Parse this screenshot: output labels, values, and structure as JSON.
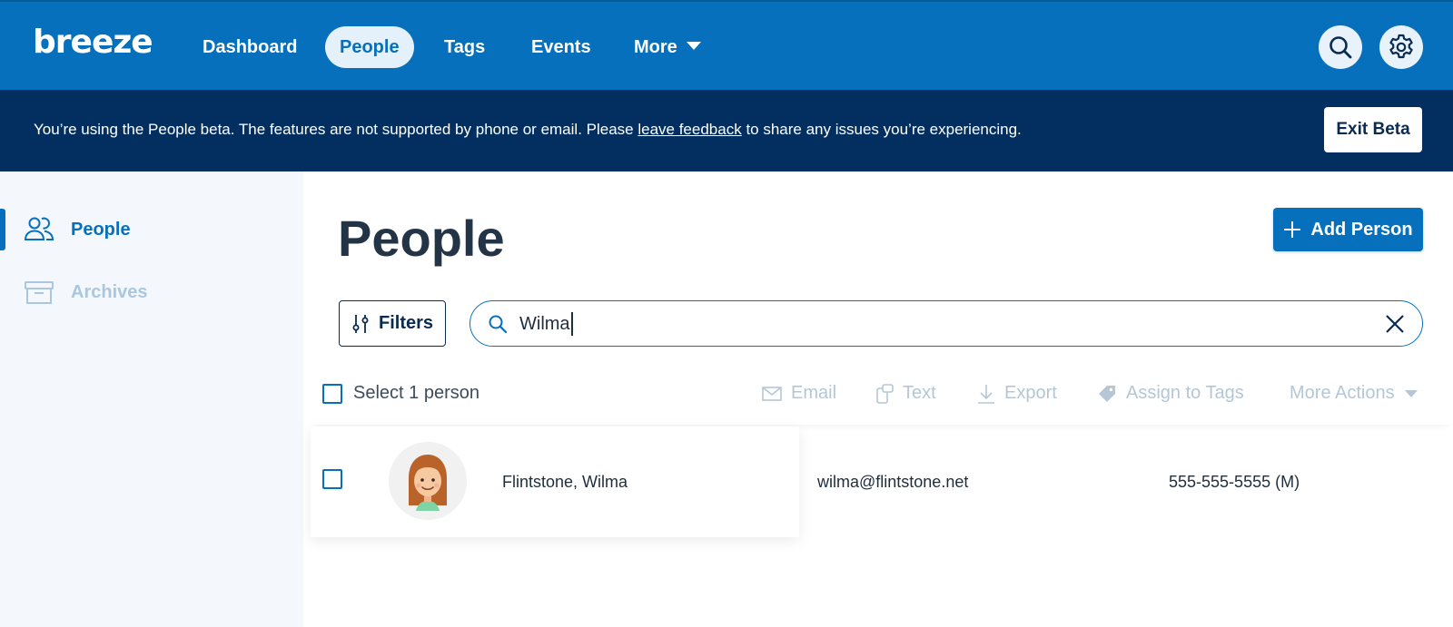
{
  "brand": {
    "logo_text": "breeze"
  },
  "nav": {
    "items": [
      {
        "label": "Dashboard"
      },
      {
        "label": "People",
        "active": true
      },
      {
        "label": "Tags"
      },
      {
        "label": "Events"
      },
      {
        "label": "More"
      }
    ],
    "search_icon": "search-icon",
    "settings_icon": "gear-icon"
  },
  "banner": {
    "text_before": "You’re using the People beta. The features are not supported by phone or email. Please ",
    "link_text": "leave feedback",
    "text_after": " to share any issues you’re experiencing.",
    "exit_label": "Exit Beta"
  },
  "sidebar": {
    "items": [
      {
        "label": "People",
        "icon": "people-icon",
        "active": true
      },
      {
        "label": "Archives",
        "icon": "archive-box-icon",
        "active": false
      }
    ]
  },
  "main": {
    "title": "People",
    "add_button_label": "Add Person",
    "filters_label": "Filters",
    "search": {
      "value": "Wilma",
      "placeholder": ""
    },
    "select_label": "Select 1 person",
    "actions": [
      {
        "label": "Email",
        "icon": "envelope-icon"
      },
      {
        "label": "Text",
        "icon": "phone-text-icon"
      },
      {
        "label": "Export",
        "icon": "download-icon"
      },
      {
        "label": "Assign to Tags",
        "icon": "tag-icon"
      },
      {
        "label": "More Actions",
        "icon": "chevron-down-icon"
      }
    ],
    "rows": [
      {
        "name": "Flintstone, Wilma",
        "email": "wilma@flintstone.net",
        "phone": "555-555-5555 (M)"
      }
    ]
  },
  "colors": {
    "primary": "#0670bd",
    "banner": "#022f60",
    "sidebar_bg": "#f4f8fc",
    "disabled_action": "#b5c6d6",
    "title": "#243447"
  }
}
